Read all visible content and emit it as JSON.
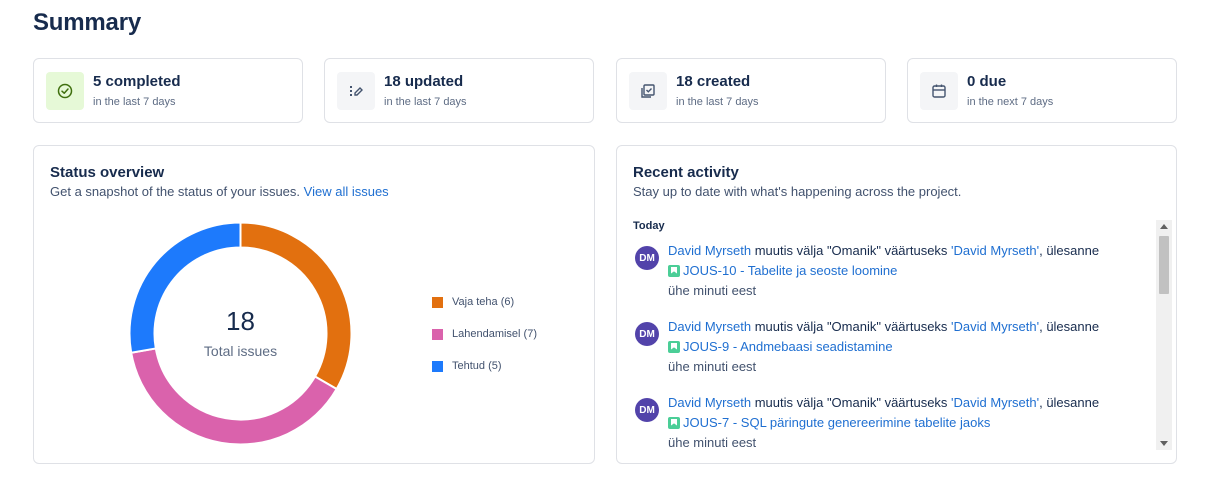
{
  "page": {
    "title": "Summary"
  },
  "stats": [
    {
      "value": "5 completed",
      "sub": "in the last 7 days",
      "icon": "check-circle-icon"
    },
    {
      "value": "18 updated",
      "sub": "in the last 7 days",
      "icon": "edit-list-icon"
    },
    {
      "value": "18 created",
      "sub": "in the last 7 days",
      "icon": "create-issue-icon"
    },
    {
      "value": "0 due",
      "sub": "in the next 7 days",
      "icon": "calendar-icon"
    }
  ],
  "status": {
    "title": "Status overview",
    "subtitle": "Get a snapshot of the status of your issues.",
    "link": "View all issues",
    "total": "18",
    "total_label": "Total issues",
    "legend": [
      "Vaja teha (6)",
      "Lahendamisel (7)",
      "Tehtud (5)"
    ]
  },
  "chart_data": {
    "type": "pie",
    "categories": [
      "Vaja teha",
      "Lahendamisel",
      "Tehtud"
    ],
    "values": [
      6,
      7,
      5
    ],
    "colors": [
      "#e2700f",
      "#da62ac",
      "#1d7afc"
    ],
    "legend_position": "right"
  },
  "activity": {
    "title": "Recent activity",
    "subtitle": "Stay up to date with what's happening across the project.",
    "day": "Today",
    "items": [
      {
        "avatar": "DM",
        "user": "David Myrseth",
        "action": " muutis välja \"Omanik\" väärtuseks ",
        "value": "'David Myrseth'",
        "suffix": ", ülesanne",
        "issue": "JOUS-10 - Tabelite ja seoste loomine",
        "time": "ühe minuti eest"
      },
      {
        "avatar": "DM",
        "user": "David Myrseth",
        "action": " muutis välja \"Omanik\" väärtuseks ",
        "value": "'David Myrseth'",
        "suffix": ", ülesanne",
        "issue": "JOUS-9 - Andmebaasi seadistamine",
        "time": "ühe minuti eest"
      },
      {
        "avatar": "DM",
        "user": "David Myrseth",
        "action": " muutis välja \"Omanik\" väärtuseks ",
        "value": "'David Myrseth'",
        "suffix": ", ülesanne",
        "issue": "JOUS-7 - SQL päringute genereerimine tabelite jaoks",
        "time": "ühe minuti eest"
      }
    ]
  },
  "colors": {
    "link": "#1f6fd1",
    "avatar": "#5243aa",
    "story": "#4bce97"
  }
}
